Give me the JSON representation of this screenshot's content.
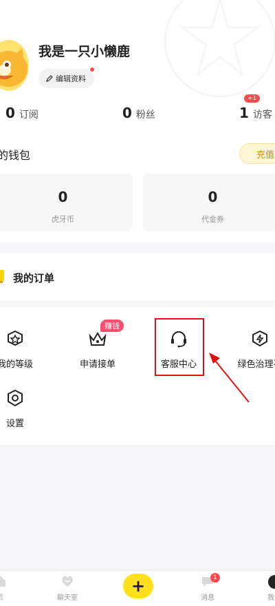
{
  "profile": {
    "username": "我是一只小懒鹿",
    "edit_label": "编辑资料"
  },
  "stats": [
    {
      "value": "0",
      "label": "订阅"
    },
    {
      "value": "0",
      "label": "粉丝"
    },
    {
      "value": "1",
      "label": "访客",
      "badge": "+1"
    }
  ],
  "wallet": {
    "title": "的钱包",
    "recharge_label": "充值",
    "cards": [
      {
        "value": "0",
        "label": "虎牙币"
      },
      {
        "value": "0",
        "label": "代金券"
      }
    ]
  },
  "orders": {
    "title": "我的订单"
  },
  "grid": {
    "items": [
      {
        "label": "我的等级",
        "icon": "level-icon"
      },
      {
        "label": "申请接单",
        "icon": "crown-icon",
        "badge": "赚钱"
      },
      {
        "label": "客服中心",
        "icon": "headset-icon"
      },
      {
        "label": "绿色治理平",
        "icon": "shield-icon"
      },
      {
        "label": "设置",
        "icon": "settings-icon"
      }
    ]
  },
  "tabbar": {
    "items": [
      {
        "label": "页",
        "icon": "home-icon"
      },
      {
        "label": "聊天室",
        "icon": "chat-room-icon"
      },
      {
        "label": "+",
        "icon": "plus-icon"
      },
      {
        "label": "消息",
        "icon": "message-icon",
        "badge": "1"
      },
      {
        "label": "我",
        "icon": "me-icon"
      }
    ]
  },
  "colors": {
    "accent_yellow": "#ffe01b",
    "badge_red": "#ff4b4b",
    "highlight_red": "#e01010",
    "recharge_text": "#e08a00"
  }
}
